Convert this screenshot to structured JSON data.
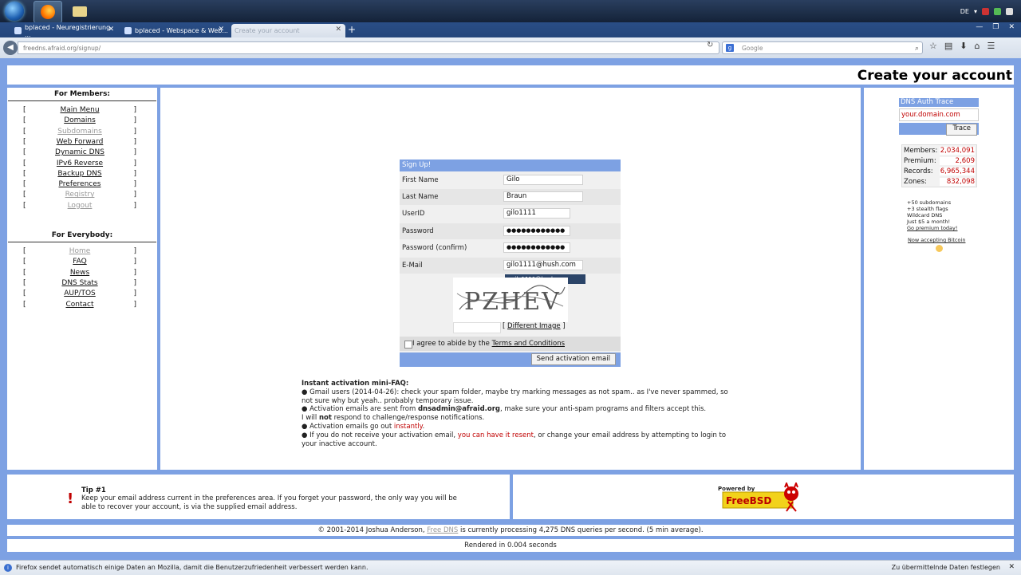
{
  "taskbar": {
    "lang": "DE"
  },
  "tabs": [
    {
      "label": "bplaced - Neuregistrierung ...",
      "active": false
    },
    {
      "label": "bplaced - Webspace & Web...",
      "active": false
    },
    {
      "label": "Create your account",
      "active": true
    }
  ],
  "nav": {
    "url": "freedns.afraid.org/signup/",
    "search_placeholder": "Google"
  },
  "page": {
    "title": "Create your account"
  },
  "members": {
    "title": "For Members:",
    "items": [
      {
        "label": "Main Menu",
        "dim": false
      },
      {
        "label": "Domains",
        "dim": false
      },
      {
        "label": "Subdomains",
        "dim": true
      },
      {
        "label": "Web Forward",
        "dim": false
      },
      {
        "label": "Dynamic DNS",
        "dim": false
      },
      {
        "label": "IPv6 Reverse",
        "dim": false
      },
      {
        "label": "Backup DNS",
        "dim": false
      },
      {
        "label": "Preferences",
        "dim": false
      },
      {
        "label": "Registry",
        "dim": true
      },
      {
        "label": "Logout",
        "dim": true
      }
    ]
  },
  "everybody": {
    "title": "For Everybody:",
    "items": [
      {
        "label": "Home",
        "dim": true
      },
      {
        "label": "FAQ",
        "dim": false
      },
      {
        "label": "News",
        "dim": false
      },
      {
        "label": "DNS Stats",
        "dim": false
      },
      {
        "label": "AUP/TOS",
        "dim": false
      },
      {
        "label": "Contact",
        "dim": false
      }
    ]
  },
  "form": {
    "header": "Sign Up!",
    "first_name_label": "First Name",
    "first_name": "Gilo",
    "last_name_label": "Last Name",
    "last_name": "Braun",
    "userid_label": "UserID",
    "userid": "gilo1111",
    "password_label": "Password",
    "password": "●●●●●●●●●●●●",
    "password_confirm_label": "Password (confirm)",
    "password_confirm": "●●●●●●●●●●●●",
    "email_label": "E-Mail",
    "email": "gilo1111@hush.com",
    "autocomplete": "gilo1111@hush.com",
    "captcha_text": "PZHEV",
    "different_image": "Different Image",
    "agree_prefix": "I agree to abide by the",
    "agree_link": "Terms and Conditions",
    "submit": "Send activation email"
  },
  "faq": {
    "title": "Instant activation mini-FAQ:",
    "b1": "Gmail users (2014-04-26): check your spam folder, maybe try marking messages as not spam.. as I've never spammed, so not sure why but yeah.. probably temporary issue.",
    "b2_pre": "Activation emails are sent from ",
    "b2_email": "dnsadmin@afraid.org",
    "b2_post": ", make sure your anti-spam programs and filters accept this.",
    "b2b_pre": "I will ",
    "b2b_not": "not",
    "b2b_post": " respond to challenge/response notifications.",
    "b3_pre": "Activation emails go out ",
    "b3_red": "instantly",
    "b3_post": ".",
    "b4_pre": "If you do not receive your activation email, ",
    "b4_red": "you can have it resent",
    "b4_post": ", or change your email address by attempting to login to your inactive account."
  },
  "dns_trace": {
    "title": "DNS Auth Trace",
    "input": "your.domain.com",
    "button": "Trace"
  },
  "stats": [
    {
      "label": "Members:",
      "value": "2,034,091"
    },
    {
      "label": "Premium:",
      "value": "2,609"
    },
    {
      "label": "Records:",
      "value": "6,965,344"
    },
    {
      "label": "Zones:",
      "value": "832,098"
    }
  ],
  "promo": {
    "l1": "+50 subdomains",
    "l2": "+3 stealth flags",
    "l3": "Wildcard DNS",
    "l4": "Just $5 a month!",
    "l5": "Go premium today!",
    "btc": "Now accepting Bitcoin"
  },
  "tip": {
    "mark": "!",
    "title": "Tip #1",
    "text": "Keep your email address current in the preferences area. If you forget your password, the only way you will be able to recover your account, is via the supplied email address."
  },
  "freebsd": {
    "powered": "Powered by",
    "name": "FreeBSD"
  },
  "footer": {
    "copy_pre": "© 2001-2014 Joshua Anderson, ",
    "copy_link": "Free DNS",
    "copy_post": " is currently processing 4,275 DNS queries per second. (5 min average).",
    "render": "Rendered in 0.004 seconds"
  },
  "notify": {
    "text": "Firefox sendet automatisch einige Daten an Mozilla, damit die Benutzerzufriedenheit verbessert werden kann.",
    "button": "Zu übermittelnde Daten festlegen"
  }
}
